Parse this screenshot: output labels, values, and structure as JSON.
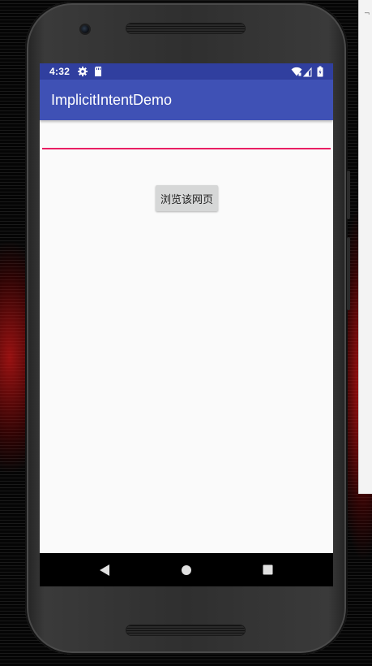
{
  "status_bar": {
    "time": "4:32",
    "icons": [
      "gear-icon",
      "sd-card-icon",
      "wifi-icon",
      "cell-signal-icon",
      "battery-icon"
    ]
  },
  "app_bar": {
    "title": "ImplicitIntentDemo"
  },
  "main": {
    "url_input": {
      "value": "",
      "placeholder": ""
    },
    "browse_button_label": "浏览该网页"
  },
  "nav_bar": {
    "buttons": [
      "back-icon",
      "home-icon",
      "recents-icon"
    ]
  },
  "colors": {
    "status_bar": "#303f9f",
    "app_bar": "#3f51b5",
    "accent": "#e91e63",
    "button": "#d6d7d7",
    "screen_background": "#fafafa"
  }
}
